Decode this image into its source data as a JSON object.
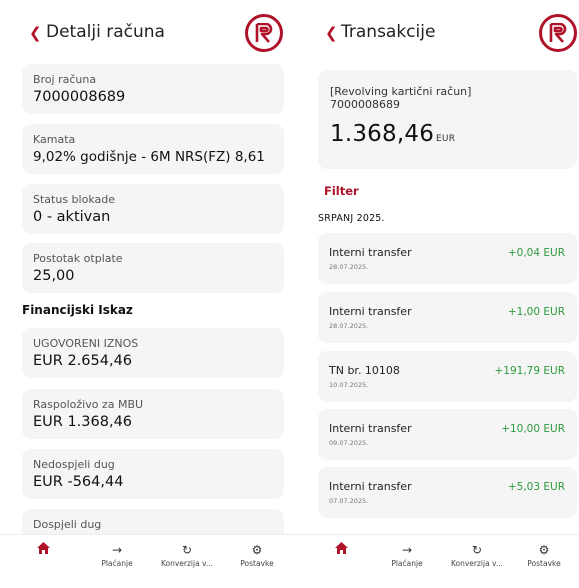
{
  "brand": {
    "accent": "#b0122a",
    "positive": "#2e9a3e",
    "card_bg": "#f5f5f5"
  },
  "left": {
    "title": "Detalji računa",
    "fields": [
      {
        "label": "Broj računa",
        "value": "7000008689"
      },
      {
        "label": "Kamata",
        "value": "9,02% godišnje - 6M NRS(FZ) 8,61"
      },
      {
        "label": "Status blokade",
        "value": "0 - aktivan"
      },
      {
        "label": "Postotak otplate",
        "value": "25,00"
      }
    ],
    "section_title": "Financijski Iskaz",
    "financial": [
      {
        "label": "UGOVORENI IZNOS",
        "value": "EUR 2.654,46"
      },
      {
        "label": "Raspoloživo za MBU",
        "value": "EUR 1.368,46"
      },
      {
        "label": "Nedospjeli dug",
        "value": "EUR -564,44"
      },
      {
        "label": "Dospjeli dug",
        "value": ""
      }
    ]
  },
  "right": {
    "title": "Transakcije",
    "account_name": "[Revolving kartični račun]",
    "account_number": "7000008689",
    "balance": "1.368,46",
    "currency": "EUR",
    "filter_label": "Filter",
    "month_label": "SRPANJ 2025.",
    "transactions": [
      {
        "desc": "Interni transfer",
        "date": "28.07.2025.",
        "amount": "+0,04 EUR"
      },
      {
        "desc": "Interni transfer",
        "date": "28.07.2025.",
        "amount": "+1,00 EUR"
      },
      {
        "desc": "TN br. 10108",
        "date": "10.07.2025.",
        "amount": "+191,79 EUR"
      },
      {
        "desc": "Interni transfer",
        "date": "09.07.2025.",
        "amount": "+10,00 EUR"
      },
      {
        "desc": "Interni transfer",
        "date": "07.07.2025.",
        "amount": "+5,03 EUR"
      }
    ]
  },
  "tabs": [
    {
      "icon": "home-icon",
      "label": ""
    },
    {
      "icon": "arrow-right-icon",
      "label": "Plaćanje"
    },
    {
      "icon": "refresh-icon",
      "label": "Konverzija v..."
    },
    {
      "icon": "gear-icon",
      "label": "Postavke"
    }
  ]
}
